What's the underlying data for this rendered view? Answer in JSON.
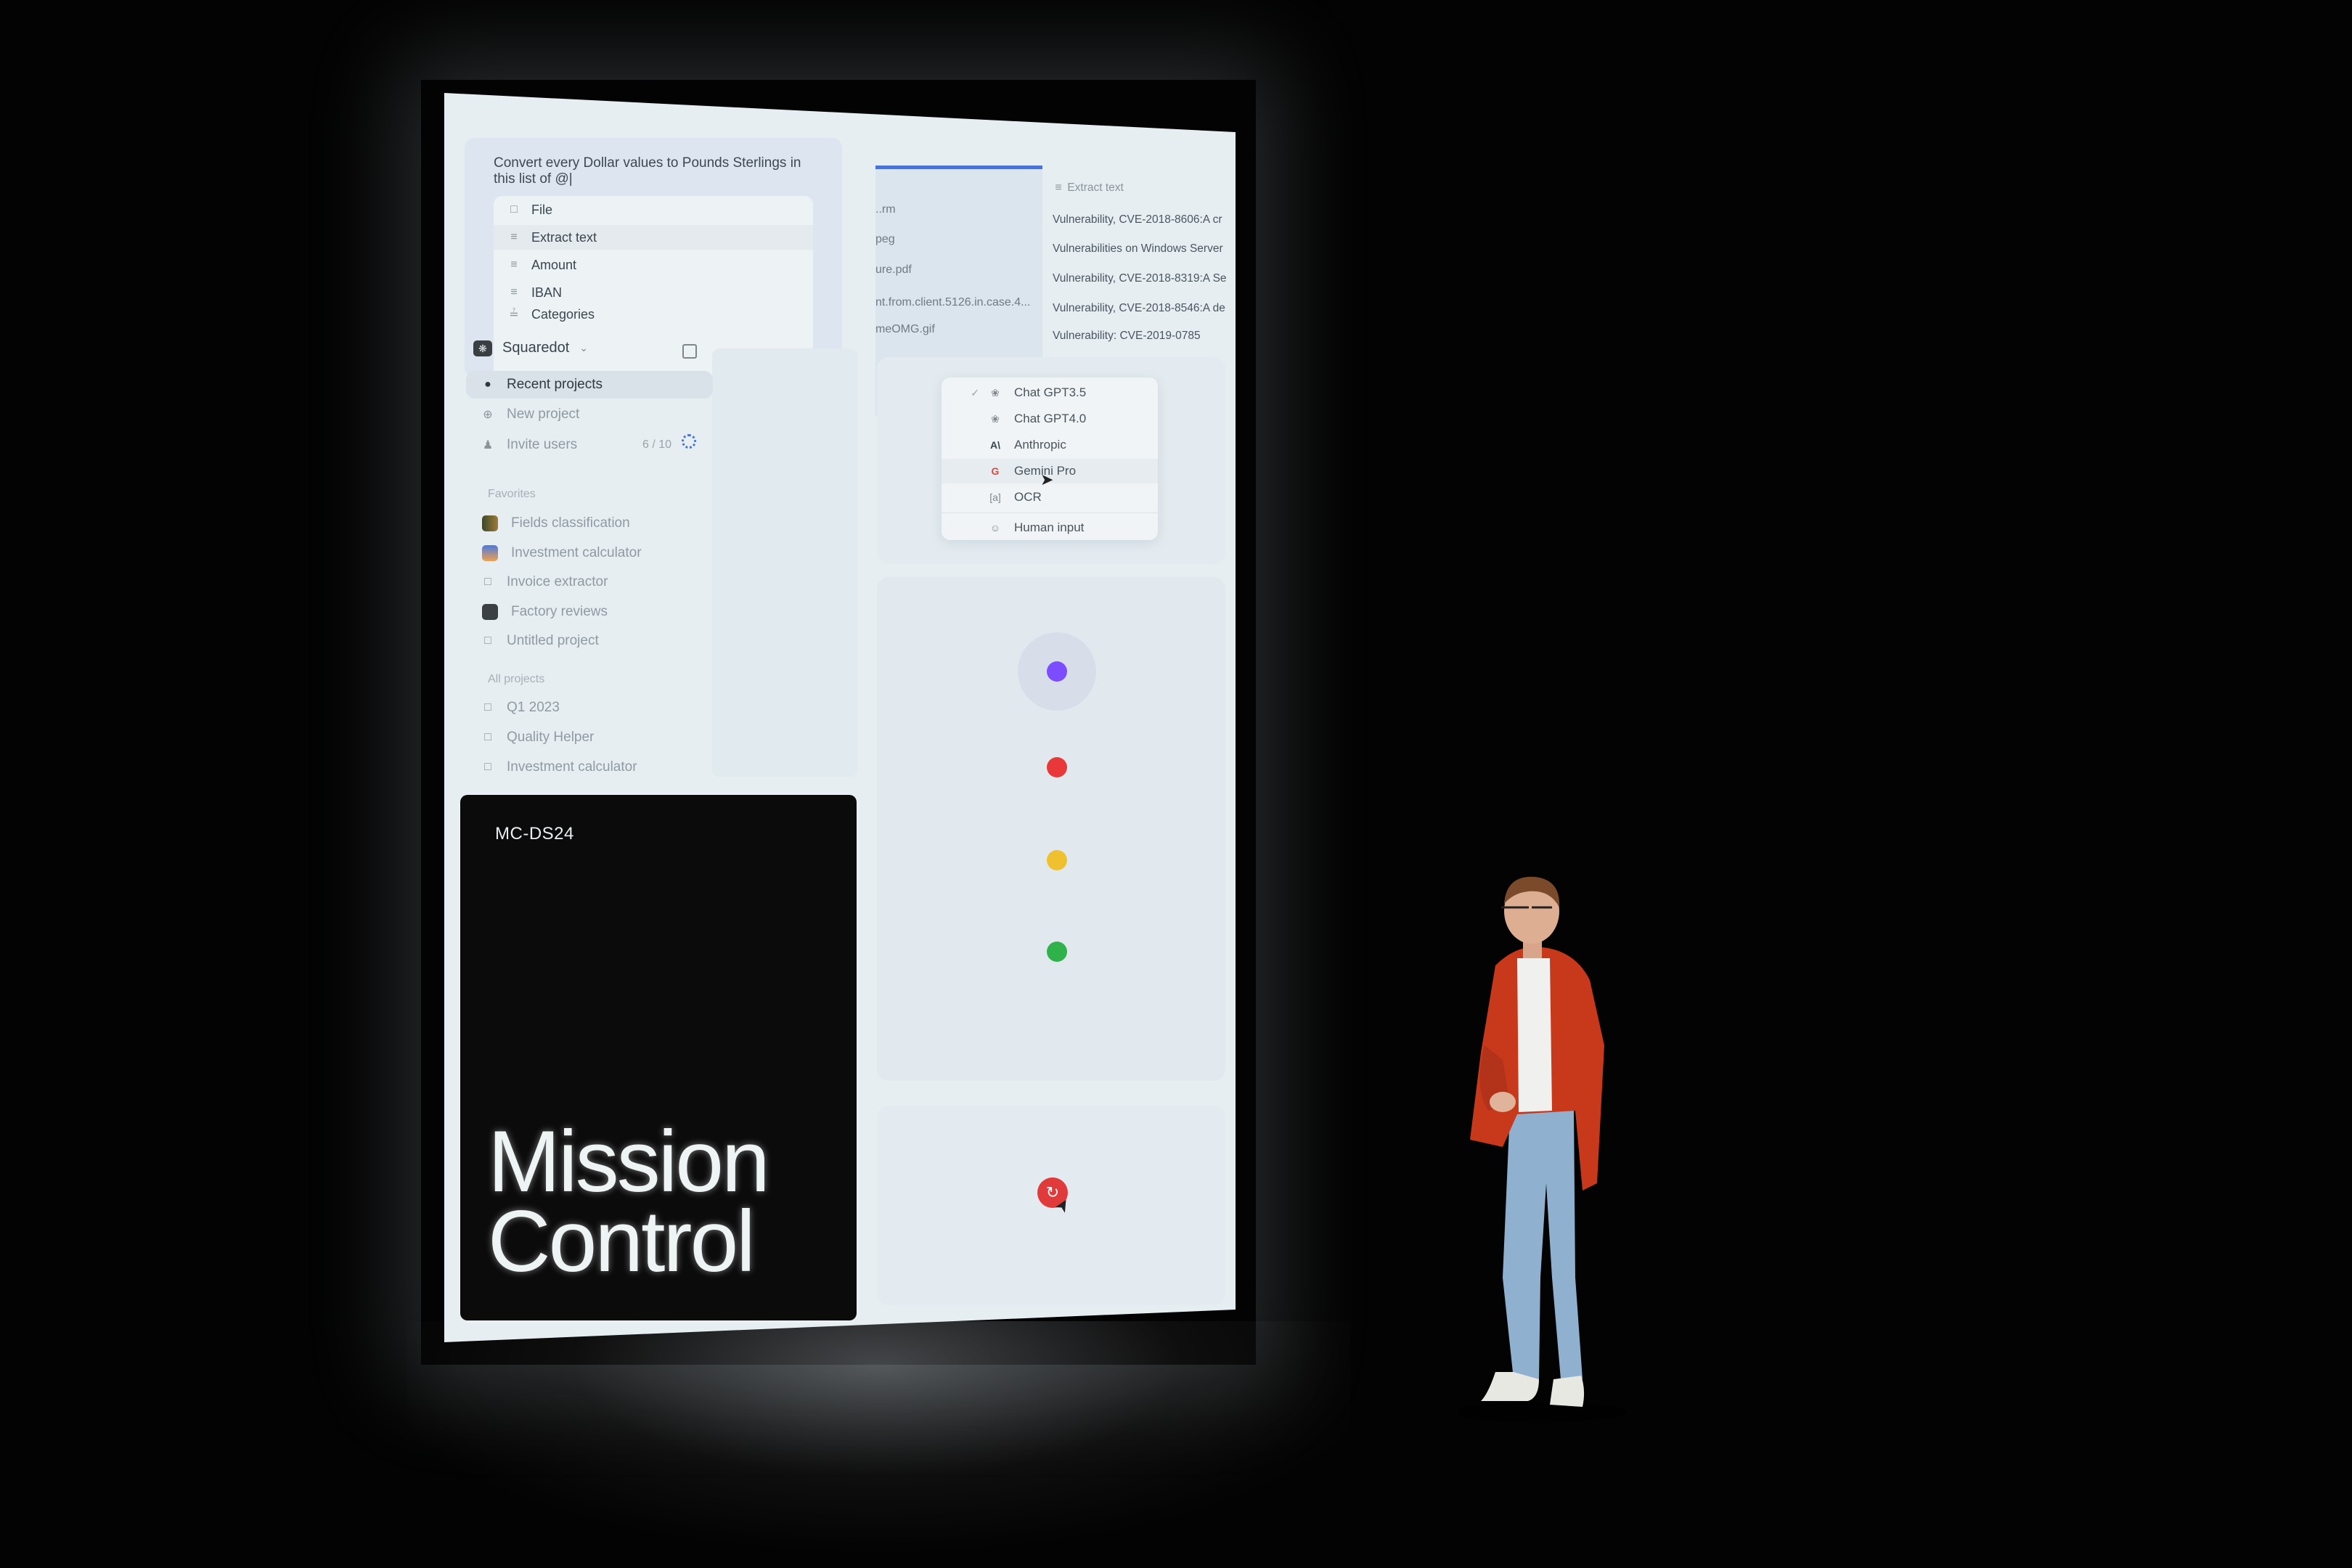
{
  "prompt": {
    "text": "Convert every Dollar values to Pounds Sterlings in this list of @|",
    "mention_menu": [
      {
        "icon": "file-icon",
        "label": "File"
      },
      {
        "icon": "text-lines-icon",
        "label": "Extract text"
      },
      {
        "icon": "text-lines-icon",
        "label": "Amount"
      },
      {
        "icon": "text-lines-icon",
        "label": "IBAN"
      },
      {
        "icon": "list-icon",
        "label": "Categories"
      }
    ]
  },
  "files": [
    "..rm",
    "peg",
    "ure.pdf",
    "nt.from.client.5126.in.case.4...",
    "meOMG.gif"
  ],
  "extract": {
    "header": "Extract text",
    "rows": [
      "Vulnerability, CVE-2018-8606:A cr",
      "Vulnerabilities on Windows Server",
      "Vulnerability, CVE-2018-8319:A Se",
      "Vulnerability, CVE-2018-8546:A de",
      "Vulnerability: CVE-2019-0785"
    ]
  },
  "sidebar": {
    "workspace": "Squaredot",
    "nav": [
      {
        "icon": "clock-icon",
        "label": "Recent projects",
        "active": true
      },
      {
        "icon": "plus-circle-icon",
        "label": "New project"
      },
      {
        "icon": "user-plus-icon",
        "label": "Invite users",
        "count": "6 / 10"
      }
    ],
    "favorites_label": "Favorites",
    "favorites": [
      "Fields classification",
      "Investment calculator",
      "Invoice extractor",
      "Factory reviews",
      "Untitled project"
    ],
    "all_label": "All projects",
    "all": [
      "Q1 2023",
      "Quality Helper",
      "Investment calculator"
    ]
  },
  "card": {
    "code": "MC-DS24",
    "title_line1": "Mission",
    "title_line2": "Control"
  },
  "model_menu": {
    "selected": "Chat GPT3.5",
    "hovered": "Gemini Pro",
    "items": [
      {
        "icon": "openai-icon",
        "label": "Chat GPT3.5"
      },
      {
        "icon": "openai-icon",
        "label": "Chat GPT4.0"
      },
      {
        "icon": "anthropic-icon",
        "label": "Anthropic"
      },
      {
        "icon": "google-icon",
        "label": "Gemini Pro"
      },
      {
        "icon": "ocr-icon",
        "label": "OCR"
      },
      {
        "icon": "user-circle-icon",
        "label": "Human input"
      }
    ]
  },
  "status_dots": {
    "colors": [
      "#7b4dff",
      "#e8383a",
      "#f0c12e",
      "#2fb24a"
    ]
  },
  "record_button": {
    "color": "#e03a3a",
    "icon": "redo-icon"
  },
  "colors": {
    "accent": "#4a73d9",
    "screen_bg": "#e6eef2"
  }
}
